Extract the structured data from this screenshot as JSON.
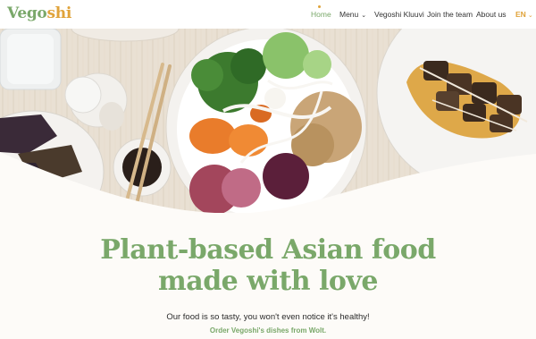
{
  "brand": {
    "logo_part1": "Vego",
    "logo_part2": "shi",
    "logo_color_primary": "#7aa86a",
    "logo_color_accent": "#e0a33a"
  },
  "nav": {
    "items": [
      {
        "label": "Home",
        "active": true
      },
      {
        "label": "Menu",
        "has_dropdown": true
      },
      {
        "label": "Vegoshi Kluuvi"
      },
      {
        "label": "Join the team"
      },
      {
        "label": "About us"
      }
    ],
    "language": "EN",
    "dropdown_icon": "chevron-down-icon"
  },
  "hero": {
    "headline_line1": "Plant-based Asian food",
    "headline_line2": "made with love",
    "tagline": "Our food is so tasty, you won't even notice it's healthy!",
    "cta": "Order Vegoshi's dishes from Wolt."
  }
}
